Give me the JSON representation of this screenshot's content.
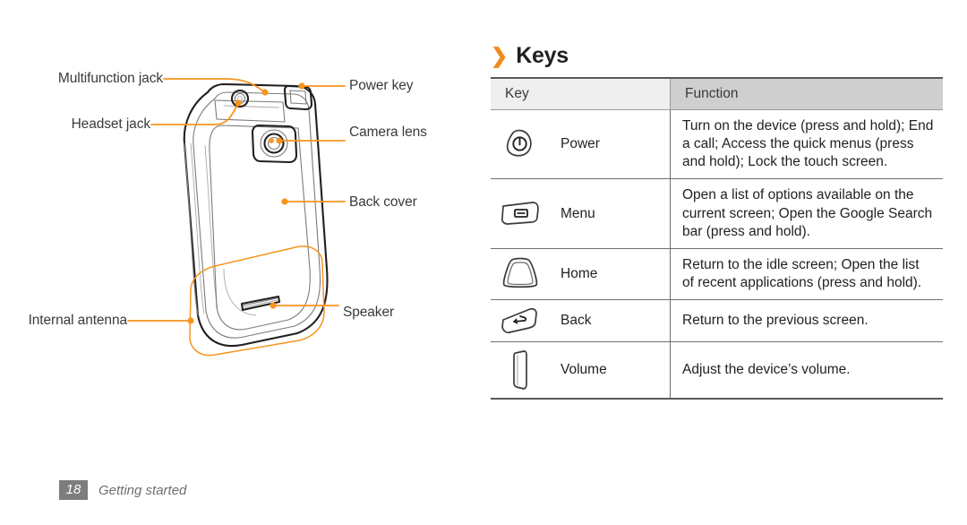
{
  "page": {
    "footer_page_number": "18",
    "footer_section": "Getting started"
  },
  "diagram": {
    "title_hidden": "",
    "callouts": [
      {
        "id": "multifunction-jack",
        "label": "Multifunction jack"
      },
      {
        "id": "headset-jack",
        "label": "Headset jack"
      },
      {
        "id": "internal-antenna",
        "label": "Internal antenna"
      },
      {
        "id": "power-key",
        "label": "Power key"
      },
      {
        "id": "camera-lens",
        "label": "Camera lens"
      },
      {
        "id": "back-cover",
        "label": "Back cover"
      },
      {
        "id": "speaker",
        "label": "Speaker"
      }
    ],
    "accent_color": "#f7941e",
    "line_color": "#231f20"
  },
  "keys_section": {
    "heading": "Keys",
    "heading_chevron": "chevron-right-icon",
    "heading_chevron_glyph": "❯",
    "table": {
      "columns": [
        "Key",
        "Function"
      ],
      "rows": [
        {
          "icon": "power-key-icon",
          "key": "Power",
          "function": "Turn on the device (press and hold); End a call; Access the quick menus (press and hold); Lock the touch screen."
        },
        {
          "icon": "menu-key-icon",
          "key": "Menu",
          "function": "Open a list of options available on the current screen; Open the Google Search bar (press and hold)."
        },
        {
          "icon": "home-key-icon",
          "key": "Home",
          "function": "Return to the idle screen; Open the list of recent applications (press and hold)."
        },
        {
          "icon": "back-key-icon",
          "key": "Back",
          "function": "Return to the previous screen."
        },
        {
          "icon": "volume-key-icon",
          "key": "Volume",
          "function": "Adjust the device’s volume."
        }
      ]
    }
  },
  "colors": {
    "accent": "#f7941e",
    "header_key_bg": "#efefef",
    "header_func_bg": "#cfcfcf",
    "text": "#231f20",
    "footer_badge": "#7d7d80"
  }
}
